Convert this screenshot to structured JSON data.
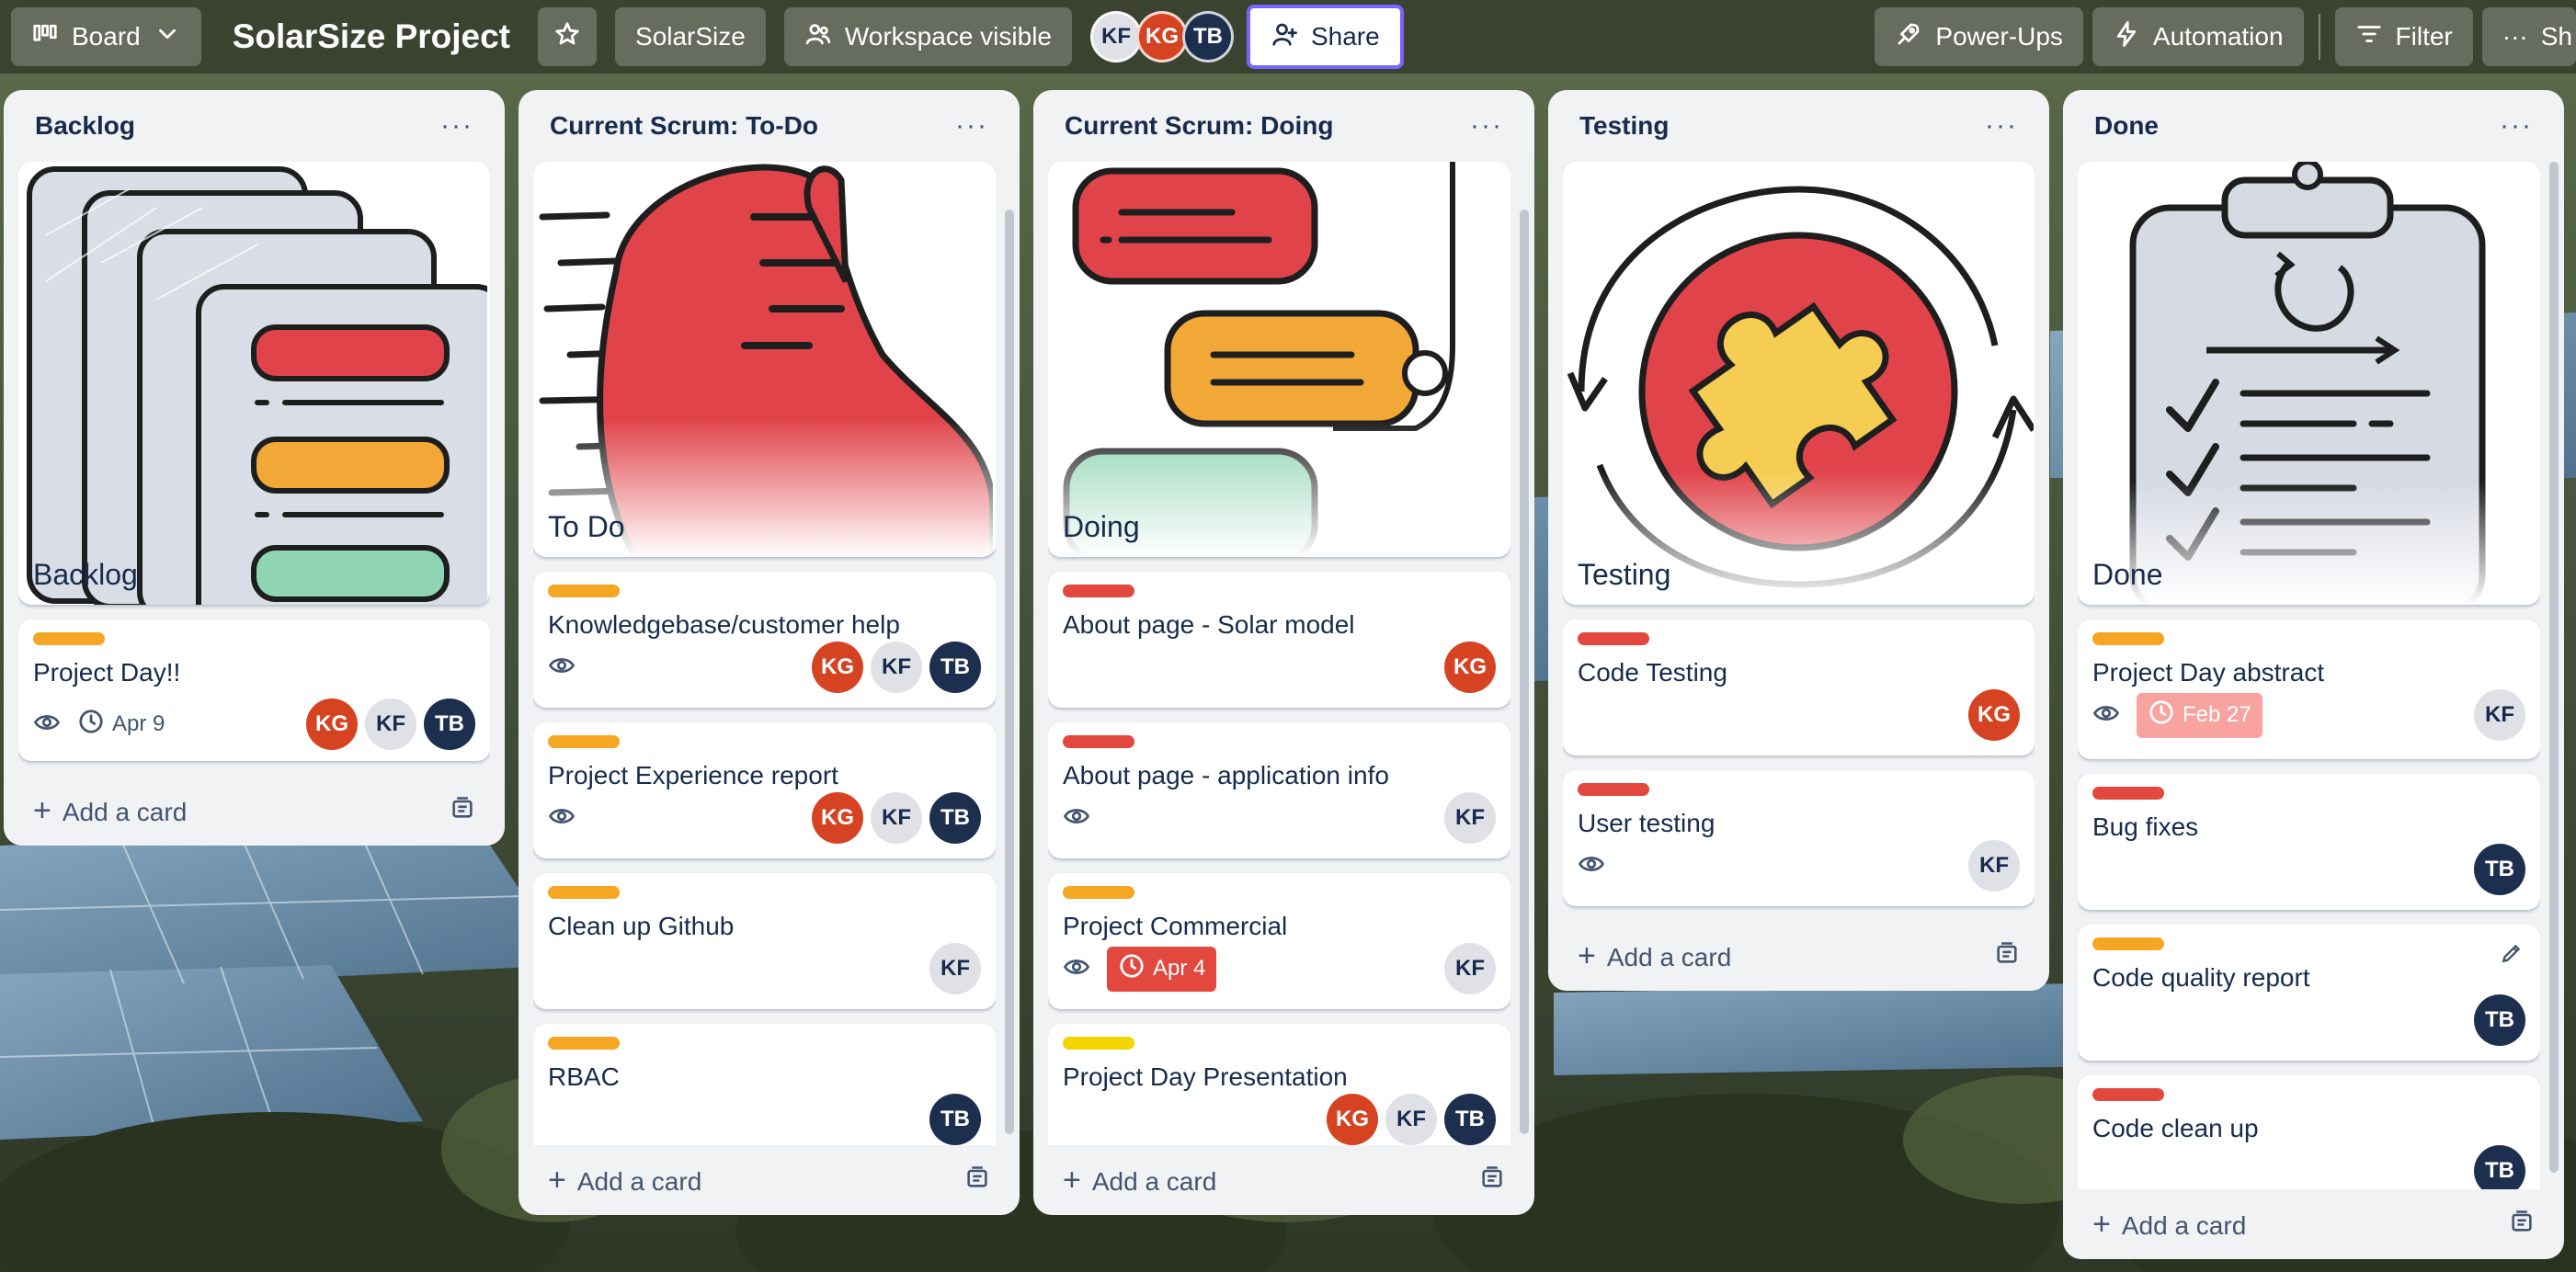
{
  "topbar": {
    "view_label": "Board",
    "board_title": "SolarSize Project",
    "workspace_label": "SolarSize",
    "visibility_label": "Workspace visible",
    "members": [
      "KF",
      "KG",
      "TB"
    ],
    "share_label": "Share",
    "powerups_label": "Power-Ups",
    "automation_label": "Automation",
    "filter_label": "Filter",
    "overflow_label": "Sh"
  },
  "colors": {
    "label_orange": "#f5a623",
    "label_red": "#e2483d",
    "label_yellow": "#f2d600",
    "avatar_kg": "#d64322",
    "avatar_kf": "#dfe1e6",
    "avatar_tb": "#1d2f4e",
    "share_border": "#7b61ff"
  },
  "lists": [
    {
      "title": "Backlog",
      "cover_title": "Backlog",
      "add_label": "Add a card",
      "cards": [
        {
          "title": "Project Day!!",
          "label": "orange",
          "watch": true,
          "date": "Apr 9",
          "members": [
            "KG",
            "KF",
            "TB"
          ]
        }
      ]
    },
    {
      "title": "Current Scrum: To-Do",
      "cover_title": "To Do",
      "add_label": "Add a card",
      "cards": [
        {
          "title": "Knowledgebase/customer help",
          "label": "orange",
          "watch": true,
          "members": [
            "KG",
            "KF",
            "TB"
          ]
        },
        {
          "title": "Project Experience report",
          "label": "orange",
          "watch": true,
          "members": [
            "KG",
            "KF",
            "TB"
          ]
        },
        {
          "title": "Clean up Github",
          "label": "orange",
          "members": [
            "KF"
          ]
        },
        {
          "title": "RBAC",
          "label": "orange",
          "members": [
            "TB"
          ]
        }
      ]
    },
    {
      "title": "Current Scrum: Doing",
      "cover_title": "Doing",
      "add_label": "Add a card",
      "cards": [
        {
          "title": "About page - Solar model",
          "label": "red",
          "members": [
            "KG"
          ]
        },
        {
          "title": "About page - application info",
          "label": "red",
          "watch": true,
          "members": [
            "KF"
          ]
        },
        {
          "title": "Project Commercial",
          "label": "orange",
          "watch": true,
          "due": "Apr 4",
          "members": [
            "KF"
          ]
        },
        {
          "title": "Project Day Presentation",
          "label": "yellow",
          "members": [
            "KG",
            "KF",
            "TB"
          ]
        }
      ]
    },
    {
      "title": "Testing",
      "cover_title": "Testing",
      "add_label": "Add a card",
      "cards": [
        {
          "title": "Code Testing",
          "label": "red",
          "members": [
            "KG"
          ]
        },
        {
          "title": "User testing",
          "label": "red",
          "watch": true,
          "members": [
            "KF"
          ]
        }
      ]
    },
    {
      "title": "Done",
      "cover_title": "Done",
      "add_label": "Add a card",
      "cards": [
        {
          "title": "Project Day abstract",
          "label": "orange",
          "watch": true,
          "due_done": "Feb 27",
          "members": [
            "KF"
          ]
        },
        {
          "title": "Bug fixes",
          "label": "red",
          "members": [
            "TB"
          ]
        },
        {
          "title": "Code quality report",
          "label": "orange",
          "members": [
            "TB"
          ]
        },
        {
          "title": "Code clean up",
          "label": "red",
          "members": [
            "TB"
          ]
        }
      ]
    }
  ]
}
